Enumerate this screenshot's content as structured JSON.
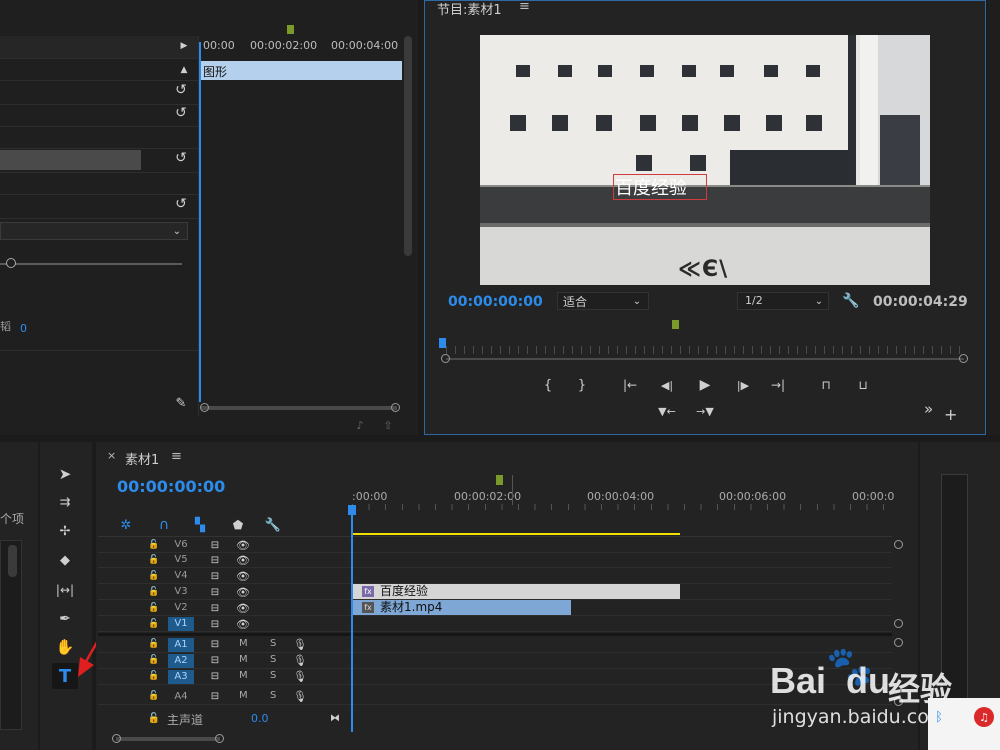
{
  "effect_controls": {
    "ruler_times": [
      "00:00",
      "00:00:02:00",
      "00:00:04:00"
    ],
    "clip_bar_label": "图形",
    "param_value": "0"
  },
  "program_monitor": {
    "title": "节目:素材1",
    "menu_glyph": "≡",
    "overlay_text": "百度经验",
    "timecode_current": "00:00:00:00",
    "fit_select": "适合",
    "resolution_select": "1/2",
    "timecode_duration": "00:00:04:29",
    "overflow_glyph": "»",
    "add_glyph": "+"
  },
  "timeline": {
    "tab_close": "×",
    "tab_label": "素材1",
    "tab_menu": "≡",
    "timecode": "00:00:00:00",
    "ruler": [
      ":00:00",
      "00:00:02:00",
      "00:00:04:00",
      "00:00:06:00",
      "00:00:0"
    ],
    "video_tracks": [
      {
        "name": "V6",
        "active": false
      },
      {
        "name": "V5",
        "active": false
      },
      {
        "name": "V4",
        "active": false
      },
      {
        "name": "V3",
        "active": false
      },
      {
        "name": "V2",
        "active": false
      },
      {
        "name": "V1",
        "active": true
      }
    ],
    "audio_tracks": [
      {
        "name": "A1",
        "m": "M",
        "s": "S"
      },
      {
        "name": "A2",
        "m": "M",
        "s": "S"
      },
      {
        "name": "A3",
        "m": "M",
        "s": "S"
      },
      {
        "name": "A4",
        "m": "M",
        "s": "S"
      }
    ],
    "master_label": "主声道",
    "master_value": "0.0",
    "clip_v3": "百度经验",
    "clip_v2": "素材1.mp4",
    "fx_badge": "fx"
  },
  "project_panel": {
    "items_count_label": "个项"
  },
  "watermark": {
    "brand": "Bai",
    "brand2": "du",
    "brand_cn": "经验",
    "url": "jingyan.baidu.com"
  },
  "colors": {
    "accent": "#2d8ceb",
    "clip_graphic": "#d6d6d6",
    "clip_video": "#7ea7d6",
    "work_area": "#f2e000",
    "arrow": "#e02020",
    "marker": "#7a9a2a"
  }
}
